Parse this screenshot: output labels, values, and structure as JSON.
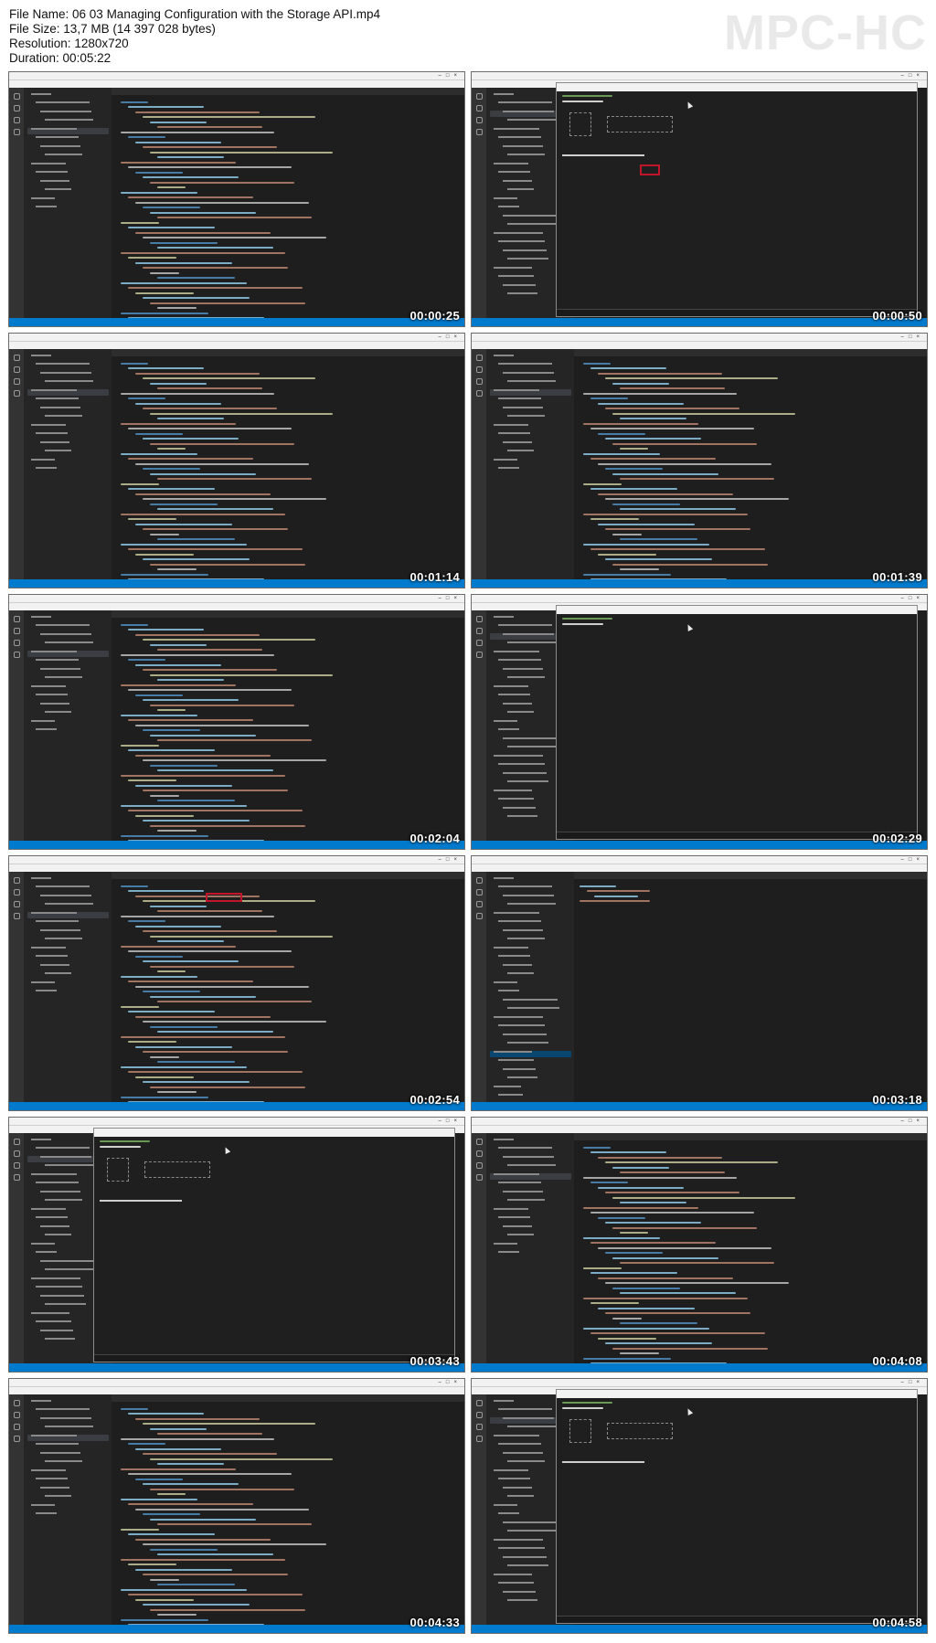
{
  "header": {
    "file_name_label": "File Name:",
    "file_name": "06 03 Managing Configuration with the Storage API.mp4",
    "file_size_label": "File Size:",
    "file_size": "13,7 MB (14 397 028 bytes)",
    "resolution_label": "Resolution:",
    "resolution": "1280x720",
    "duration_label": "Duration:",
    "duration": "00:05:22"
  },
  "brand": "MPC-HC",
  "thumbnails": [
    {
      "timestamp": "00:00:25"
    },
    {
      "timestamp": "00:00:50"
    },
    {
      "timestamp": "00:01:14"
    },
    {
      "timestamp": "00:01:39"
    },
    {
      "timestamp": "00:02:04"
    },
    {
      "timestamp": "00:02:29"
    },
    {
      "timestamp": "00:02:54"
    },
    {
      "timestamp": "00:03:18"
    },
    {
      "timestamp": "00:03:43"
    },
    {
      "timestamp": "00:04:08"
    },
    {
      "timestamp": "00:04:33"
    },
    {
      "timestamp": "00:04:58"
    }
  ],
  "colors": {
    "editor_bg": "#1e1e1e",
    "sidebar_bg": "#252526",
    "statusbar": "#007acc",
    "highlight_box": "#c0152a",
    "syntax_keyword": "#569cd6",
    "syntax_string": "#ce9178",
    "syntax_function": "#dcdcaa",
    "syntax_property": "#9cdcfe",
    "terminal_green": "#6a9955"
  }
}
